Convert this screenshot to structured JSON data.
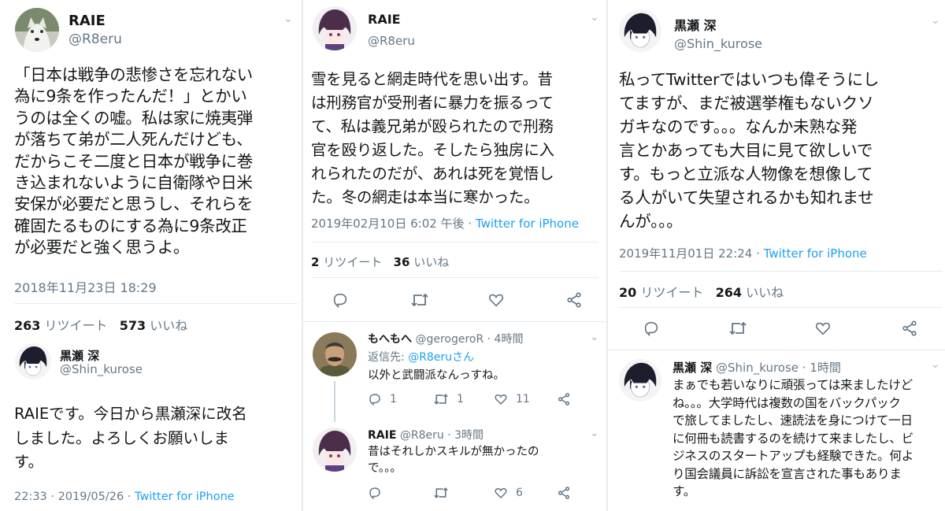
{
  "col1": {
    "tweet": {
      "name": "RAIE",
      "handle": "@R8eru",
      "text": "「日本は戦争の悲惨さを忘れない\n為に9条を作ったんだ！」とかい\nうのは全くの嘘。私は家に焼夷弾\nが落ちて弟が二人死んだけども、\nだからこそ二度と日本が戦争に巻\nき込まれないように自衛隊や日米\n安保が必要だと思うし、それらを\n確固たるものにする為に9条改正\nが必要だと強く思うよ。",
      "timestamp": "2018年11月23日 18:29",
      "retweets": "263",
      "retweets_label": "リツイート",
      "likes": "573",
      "likes_label": "いいね"
    },
    "tweet2": {
      "name": "黒瀬 深",
      "handle": "@Shin_kurose",
      "text": "RAIEです。今日から黒瀬深に改名\nしました。よろしくお願いしま\nす。",
      "time": "22:33 · 2019/05/26 ·",
      "source": "Twitter for iPhone"
    }
  },
  "col2": {
    "tweet": {
      "name": "RAIE",
      "handle": "@R8eru",
      "text": "雪を見ると網走時代を思い出す。昔\nは刑務官が受刑者に暴力を振るって\nて、私は義兄弟が殴られたので刑務\n官を殴り返した。そしたら独房に入\nれられたのだが、あれは死を覚悟し\nた。冬の網走は本当に寒かった。",
      "timestamp": "2019年02月10日 6:02 午後 ·",
      "source": "Twitter for iPhone",
      "retweets": "2",
      "retweets_label": "リツイート",
      "likes": "36",
      "likes_label": "いいね"
    },
    "reply1": {
      "name": "もへもへ",
      "handle": "@gerogeroR · 4時間",
      "reply_to_label": "返信先:",
      "reply_to": "@R8eruさん",
      "text": "以外と武闘派なんっすね。",
      "replies": "1",
      "retweets": "1",
      "likes": "11"
    },
    "reply2": {
      "name": "RAIE",
      "handle": "@R8eru · 3時間",
      "text": "昔はそれしかスキルが無かったの\nで。。。",
      "likes": "6"
    }
  },
  "col3": {
    "tweet": {
      "name": "黒瀬 深",
      "handle": "@Shin_kurose",
      "text": "私ってTwitterではいつも偉そうにし\nてますが、まだ被選挙権もないクソ\nガキなのです。。。なんか未熟な発\n言とかあっても大目に見て欲しいで\nす。もっと立派な人物像を想像して\nる人がいて失望されるかも知れませ\nんが。。。",
      "timestamp": "2019年11月01日 22:24 ·",
      "source": "Twitter for iPhone",
      "retweets": "20",
      "retweets_label": "リツイート",
      "likes": "264",
      "likes_label": "いいね"
    },
    "reply": {
      "name": "黒瀬 深",
      "handle": "@Shin_kurose · 1時間",
      "text": "まぁでも若いなりに頑張っては来ましたけど\nね。。。大学時代は複数の国をバックパック\nで旅してましたし、速読法を身につけて一日\nに何冊も読書するのを続けて来ましたし、ビ\nジネスのスタートアップも経験できた。何よ\nり国会議員に訴訟を宣言された事もありま\nす。"
    }
  },
  "colors": {
    "text": "#14171a",
    "muted": "#657786",
    "link": "#1da1f2",
    "divider": "#e6ecf0"
  }
}
